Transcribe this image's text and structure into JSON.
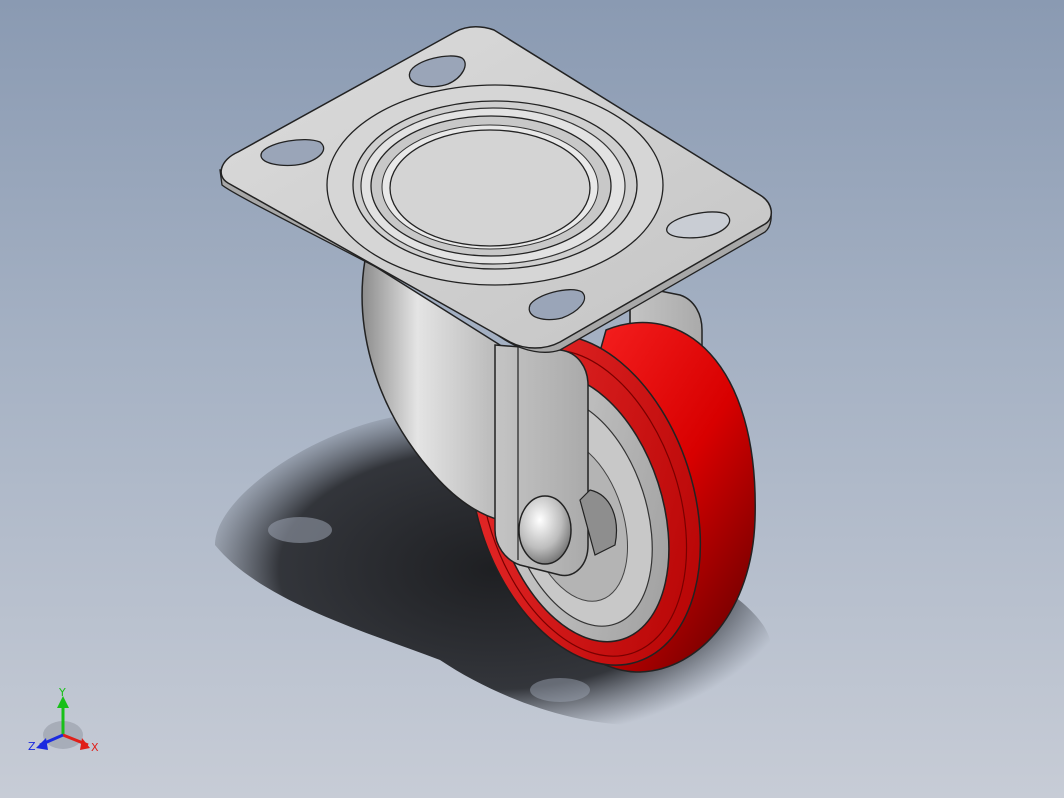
{
  "viewport": {
    "background_top": "#8a9ab2",
    "background_bottom": "#c7ccd6"
  },
  "model": {
    "name_icon": "swivel-caster-icon",
    "wheel_color": "#e00000",
    "metal_color": "#d2d2d2",
    "shadow_color": "#2a2c30"
  },
  "triad": {
    "x_label": "X",
    "y_label": "Y",
    "z_label": "Z",
    "x_color": "#e0201a",
    "y_color": "#18c018",
    "z_color": "#1a2ae0"
  }
}
